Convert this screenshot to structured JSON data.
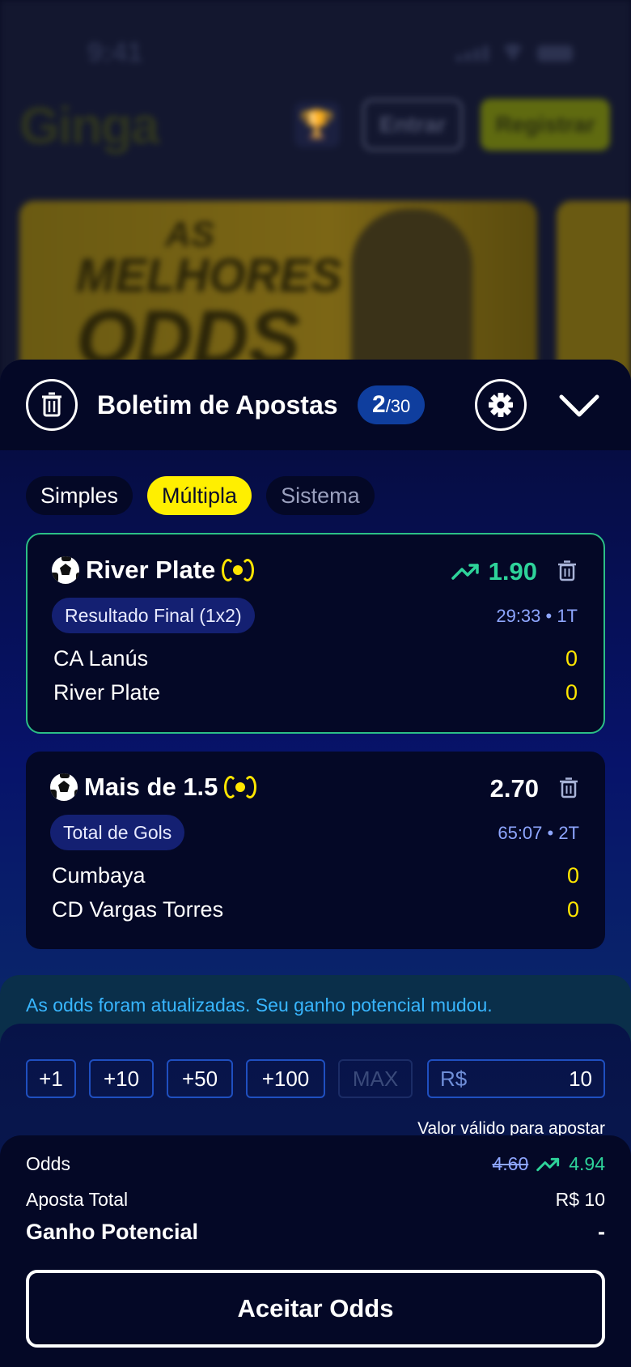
{
  "background": {
    "status_time": "9:41",
    "logo": "Ginga",
    "buttons": {
      "login": "Entrar",
      "register": "Registrar"
    },
    "banner": {
      "line1": "AS",
      "line2": "MELHORES",
      "line3": "ODDS"
    }
  },
  "slip": {
    "title": "Boletim de Apostas",
    "count": "2",
    "count_max": "/30",
    "tabs": [
      {
        "label": "Simples",
        "active": false
      },
      {
        "label": "Múltipla",
        "active": true
      },
      {
        "label": "Sistema",
        "active": false
      }
    ],
    "bets": [
      {
        "selection": "River Plate",
        "odds": "1.90",
        "odds_trend": "up",
        "market": "Resultado Final (1x2)",
        "time": "29:33 • 1T",
        "home": {
          "team": "CA Lanús",
          "score": "0"
        },
        "away": {
          "team": "River Plate",
          "score": "0"
        }
      },
      {
        "selection": "Mais de 1.5",
        "odds": "2.70",
        "odds_trend": "none",
        "market": "Total de Gols",
        "time": "65:07 • 2T",
        "home": {
          "team": "Cumbaya",
          "score": "0"
        },
        "away": {
          "team": "CD Vargas Torres",
          "score": "0"
        }
      }
    ],
    "notice": "As odds foram atualizadas. Seu ganho potencial mudou.",
    "quick_amounts": [
      "+1",
      "+10",
      "+50",
      "+100",
      "MAX"
    ],
    "stake": {
      "currency": "R$",
      "value": "10"
    },
    "valid_text": "Valor válido para apostar",
    "summary": {
      "odds_label": "Odds",
      "odds_old": "4.60",
      "odds_new": "4.94",
      "total_label": "Aposta Total",
      "total_value": "R$ 10",
      "potential_label": "Ganho Potencial",
      "potential_value": "-"
    },
    "accept_button": "Aceitar Odds"
  },
  "colors": {
    "accent_yellow": "#ffef00",
    "odds_up_green": "#2ed39a",
    "info_blue": "#38b6ff",
    "sheet_dark": "#040826"
  }
}
